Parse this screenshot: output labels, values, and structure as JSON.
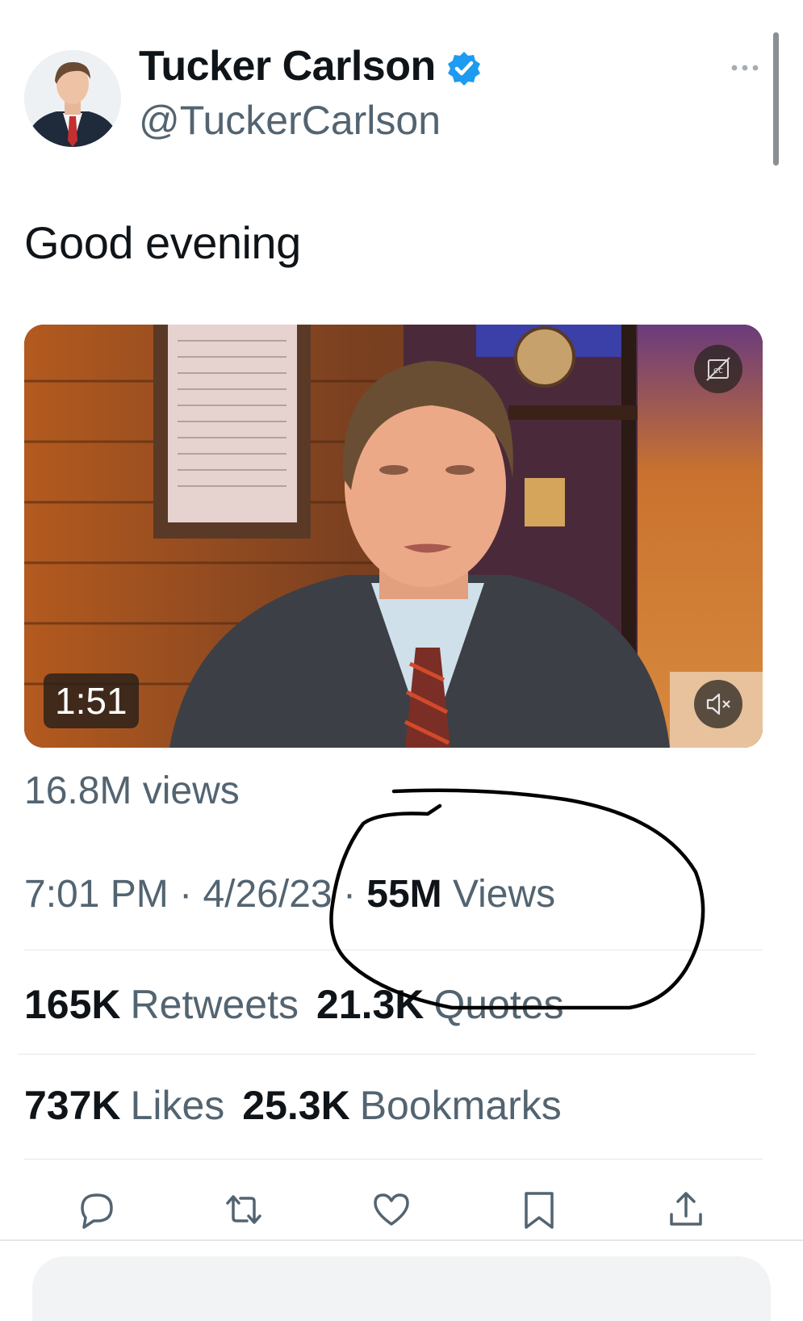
{
  "author": {
    "name": "Tucker Carlson",
    "handle": "@TuckerCarlson",
    "verified_icon": "verified-badge-icon"
  },
  "tweet": {
    "text": "Good evening"
  },
  "video": {
    "duration": "1:51",
    "icons": [
      "captions-icon",
      "muted-speaker-icon"
    ]
  },
  "stats": {
    "video_views": "16.8M views",
    "time": "7:01 PM",
    "date": "4/26/23",
    "separator": "·",
    "views_count": "55M",
    "views_label": "Views",
    "retweets_count": "165K",
    "retweets_label": "Retweets",
    "quotes_count": "21.3K",
    "quotes_label": "Quotes",
    "likes_count": "737K",
    "likes_label": "Likes",
    "bookmarks_count": "25.3K",
    "bookmarks_label": "Bookmarks"
  },
  "actions": [
    "reply-icon",
    "retweet-icon",
    "like-icon",
    "bookmark-icon",
    "share-icon"
  ],
  "colors": {
    "text_primary": "#0f1419",
    "text_secondary": "#536471",
    "verified_blue": "#1d9bf0",
    "annotation": "#000000"
  }
}
